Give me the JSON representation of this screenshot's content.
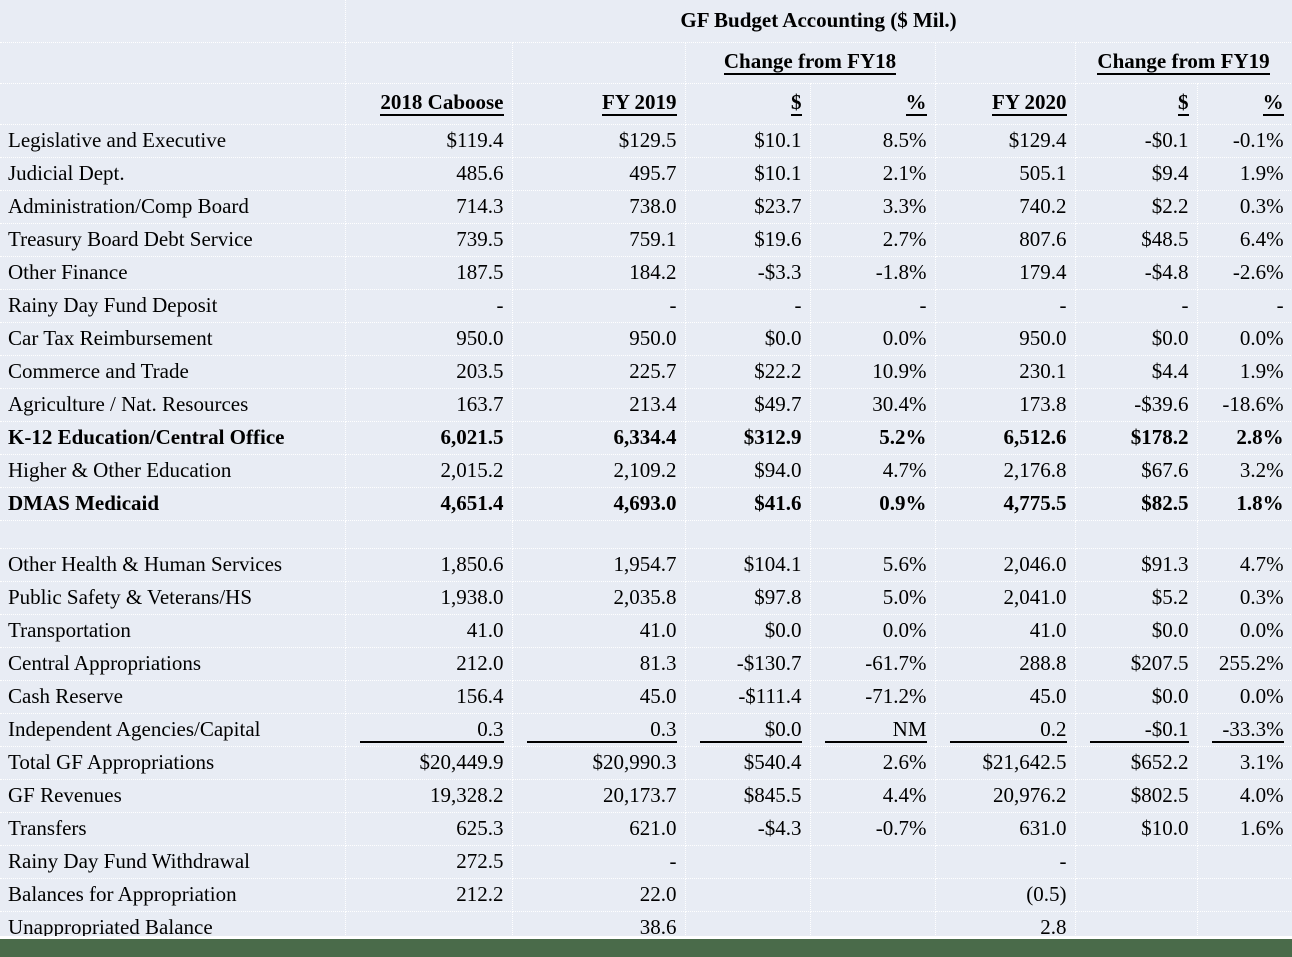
{
  "header": {
    "title": "GF Budget Accounting ($ Mil.)",
    "group_fy18": "Change from FY18",
    "group_fy19": "Change from FY19",
    "col_label": "",
    "col_caboose": "2018 Caboose",
    "col_fy2019": "FY 2019",
    "col_change18_dollar": "$",
    "col_change18_pct": "%",
    "col_fy2020": "FY 2020",
    "col_change19_dollar": "$",
    "col_change19_pct": "%"
  },
  "colors": {
    "cell_background": "#e8ecf4",
    "gridline": "#ffffff",
    "text": "#000000",
    "bottom_band": "#4a6b4a"
  },
  "rows": [
    {
      "label": "Legislative and Executive",
      "caboose": "$119.4",
      "fy2019": "$129.5",
      "d18": "$10.1",
      "p18": "8.5%",
      "fy2020": "$129.4",
      "d19": "-$0.1",
      "p19": "-0.1%",
      "bold": false
    },
    {
      "label": "Judicial Dept.",
      "caboose": "485.6",
      "fy2019": "495.7",
      "d18": "$10.1",
      "p18": "2.1%",
      "fy2020": "505.1",
      "d19": "$9.4",
      "p19": "1.9%",
      "bold": false
    },
    {
      "label": "Administration/Comp Board",
      "caboose": "714.3",
      "fy2019": "738.0",
      "d18": "$23.7",
      "p18": "3.3%",
      "fy2020": "740.2",
      "d19": "$2.2",
      "p19": "0.3%",
      "bold": false
    },
    {
      "label": "Treasury Board Debt Service",
      "caboose": "739.5",
      "fy2019": "759.1",
      "d18": "$19.6",
      "p18": "2.7%",
      "fy2020": "807.6",
      "d19": "$48.5",
      "p19": "6.4%",
      "bold": false
    },
    {
      "label": "Other Finance",
      "caboose": "187.5",
      "fy2019": "184.2",
      "d18": "-$3.3",
      "p18": "-1.8%",
      "fy2020": "179.4",
      "d19": "-$4.8",
      "p19": "-2.6%",
      "bold": false
    },
    {
      "label": " Rainy Day Fund Deposit",
      "caboose": "-",
      "fy2019": "-",
      "d18": "-",
      "p18": "-",
      "fy2020": "-",
      "d19": "-",
      "p19": "-",
      "bold": false
    },
    {
      "label": "Car Tax Reimbursement",
      "caboose": "950.0",
      "fy2019": "950.0",
      "d18": "$0.0",
      "p18": "0.0%",
      "fy2020": "950.0",
      "d19": "$0.0",
      "p19": "0.0%",
      "bold": false
    },
    {
      "label": "Commerce and Trade",
      "caboose": "203.5",
      "fy2019": "225.7",
      "d18": "$22.2",
      "p18": "10.9%",
      "fy2020": "230.1",
      "d19": "$4.4",
      "p19": "1.9%",
      "bold": false
    },
    {
      "label": "Agriculture / Nat. Resources",
      "caboose": "163.7",
      "fy2019": "213.4",
      "d18": "$49.7",
      "p18": "30.4%",
      "fy2020": "173.8",
      "d19": "-$39.6",
      "p19": "-18.6%",
      "bold": false
    },
    {
      "label": "K-12 Education/Central Office",
      "caboose": "6,021.5",
      "fy2019": "6,334.4",
      "d18": "$312.9",
      "p18": "5.2%",
      "fy2020": "6,512.6",
      "d19": "$178.2",
      "p19": "2.8%",
      "bold": true
    },
    {
      "label": "Higher & Other Education",
      "caboose": "2,015.2",
      "fy2019": "2,109.2",
      "d18": "$94.0",
      "p18": "4.7%",
      "fy2020": "2,176.8",
      "d19": "$67.6",
      "p19": "3.2%",
      "bold": false
    },
    {
      "label": "DMAS Medicaid",
      "caboose": "4,651.4",
      "fy2019": "4,693.0",
      "d18": "$41.6",
      "p18": "0.9%",
      "fy2020": "4,775.5",
      "d19": "$82.5",
      "p19": "1.8%",
      "bold": true
    },
    {
      "label": "",
      "caboose": "",
      "fy2019": "",
      "d18": "",
      "p18": "",
      "fy2020": "",
      "d19": "",
      "p19": "",
      "bold": false,
      "spacer": true
    },
    {
      "label": "Other Health & Human Services",
      "caboose": "1,850.6",
      "fy2019": "1,954.7",
      "d18": "$104.1",
      "p18": "5.6%",
      "fy2020": "2,046.0",
      "d19": "$91.3",
      "p19": "4.7%",
      "bold": false
    },
    {
      "label": "Public Safety & Veterans/HS",
      "caboose": "1,938.0",
      "fy2019": "2,035.8",
      "d18": "$97.8",
      "p18": "5.0%",
      "fy2020": "2,041.0",
      "d19": "$5.2",
      "p19": "0.3%",
      "bold": false
    },
    {
      "label": "Transportation",
      "caboose": "41.0",
      "fy2019": "41.0",
      "d18": "$0.0",
      "p18": "0.0%",
      "fy2020": "41.0",
      "d19": "$0.0",
      "p19": "0.0%",
      "bold": false
    },
    {
      "label": "Central Appropriations",
      "caboose": "212.0",
      "fy2019": "81.3",
      "d18": "-$130.7",
      "p18": "-61.7%",
      "fy2020": "288.8",
      "d19": "$207.5",
      "p19": "255.2%",
      "bold": false
    },
    {
      "label": "Cash Reserve",
      "caboose": "156.4",
      "fy2019": "45.0",
      "d18": "-$111.4",
      "p18": "-71.2%",
      "fy2020": "45.0",
      "d19": "$0.0",
      "p19": "0.0%",
      "bold": false
    },
    {
      "label": "Independent Agencies/Capital",
      "caboose": "0.3",
      "fy2019": "0.3",
      "d18": "$0.0",
      "p18": "NM",
      "fy2020": "0.2",
      "d19": "-$0.1",
      "p19": "-33.3%",
      "bold": false,
      "ruled": true
    },
    {
      "label": "Total GF Appropriations",
      "caboose": "$20,449.9",
      "fy2019": "$20,990.3",
      "d18": "$540.4",
      "p18": "2.6%",
      "fy2020": "$21,642.5",
      "d19": "$652.2",
      "p19": "3.1%",
      "bold": false
    },
    {
      "label": "GF  Revenues",
      "caboose": "19,328.2",
      "fy2019": "20,173.7",
      "d18": "$845.5",
      "p18": "4.4%",
      "fy2020": "20,976.2",
      "d19": "$802.5",
      "p19": "4.0%",
      "bold": false
    },
    {
      "label": "Transfers",
      "caboose": "625.3",
      "fy2019": "621.0",
      "d18": "-$4.3",
      "p18": "-0.7%",
      "fy2020": "631.0",
      "d19": "$10.0",
      "p19": "1.6%",
      "bold": false
    },
    {
      "label": "Rainy Day Fund Withdrawal",
      "caboose": "272.5",
      "fy2019": "-",
      "d18": "",
      "p18": "",
      "fy2020": "-",
      "d19": "",
      "p19": "",
      "bold": false
    },
    {
      "label": "Balances for Appropriation",
      "caboose": "212.2",
      "fy2019": "22.0",
      "d18": "",
      "p18": "",
      "fy2020": "(0.5)",
      "d19": "",
      "p19": "",
      "bold": false
    },
    {
      "label": "Unappropriated Balance",
      "caboose": "",
      "fy2019": "38.6",
      "d18": "",
      "p18": "",
      "fy2020": "2.8",
      "d19": "",
      "p19": "",
      "bold": false
    }
  ]
}
